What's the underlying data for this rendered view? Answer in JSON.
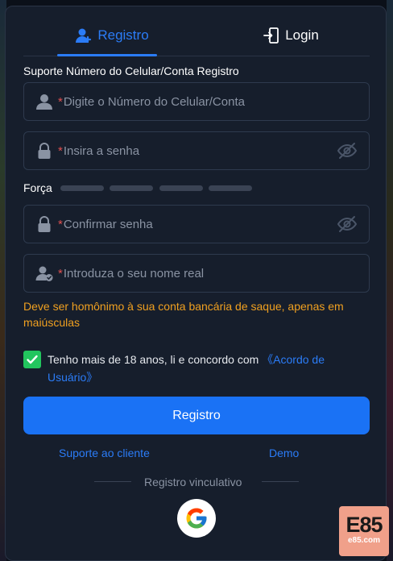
{
  "tabs": {
    "register": "Registro",
    "login": "Login"
  },
  "form": {
    "section_label": "Suporte Número do Celular/Conta Registro",
    "phone_placeholder": "Digite o Número do Celular/Conta",
    "password_placeholder": "Insira a senha",
    "strength_label": "Força",
    "strength_levels": 4,
    "confirm_placeholder": "Confirmar senha",
    "realname_placeholder": "Introduza o seu nome real",
    "required_mark": "*",
    "warning": "Deve ser homônimo à sua conta bancária de saque, apenas em maiúsculas",
    "agree_text": "Tenho mais de 18 anos, li e concordo com ",
    "agree_link": "《Acordo de Usuário》",
    "agree_checked": true,
    "register_button": "Registro"
  },
  "footer": {
    "support_link": "Suporte ao cliente",
    "demo_link": "Demo",
    "divider_text": "Registro vinculativo"
  },
  "watermark": {
    "big": "E85",
    "small": "e85.com"
  },
  "colors": {
    "accent": "#1a72f5",
    "warning": "#f0a020",
    "check": "#22c55e",
    "required": "#e05050"
  },
  "icons": {
    "register_tab": "user-plus-icon",
    "login_tab": "login-door-icon",
    "phone_field": "user-icon",
    "password_field": "lock-icon",
    "password_toggle": "eye-off-icon",
    "realname_field": "user-check-icon",
    "social": "google-icon"
  }
}
